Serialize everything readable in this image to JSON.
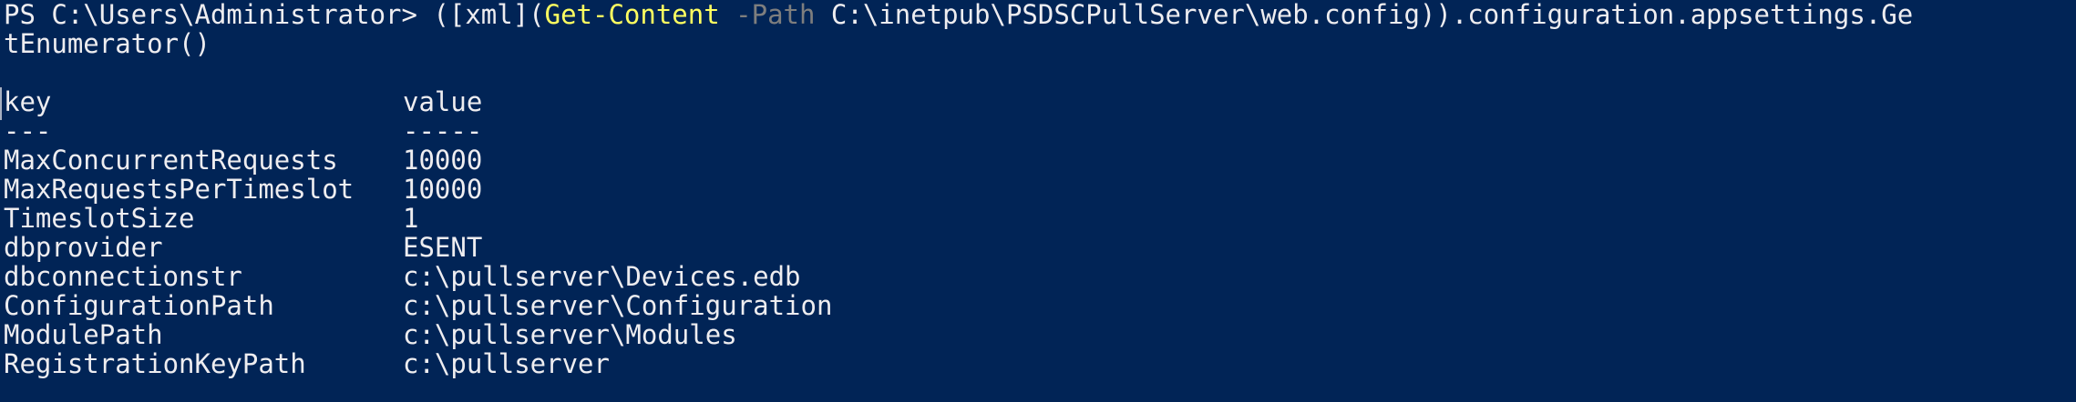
{
  "console": {
    "prompt": "PS C:\\Users\\Administrator> ",
    "command_prefix": "([xml](",
    "cmdlet": "Get-Content",
    "param_name": " -Path",
    "command_rest": " C:\\inetpub\\PSDSCPullServer\\web.config)).configuration.appsettings.Ge",
    "command_wrap": "tEnumerator()",
    "colors": {
      "background": "#012456",
      "text": "#eeedf0",
      "cmdlet": "#ffff60",
      "parameter": "#7e7e7e"
    }
  },
  "table": {
    "headers": {
      "key": "key",
      "value": "value"
    },
    "separators": {
      "key": "---",
      "value": "-----"
    },
    "rows": [
      {
        "key": "MaxConcurrentRequests",
        "value": "10000"
      },
      {
        "key": "MaxRequestsPerTimeslot",
        "value": "10000"
      },
      {
        "key": "TimeslotSize",
        "value": "1"
      },
      {
        "key": "dbprovider",
        "value": "ESENT"
      },
      {
        "key": "dbconnectionstr",
        "value": "c:\\pullserver\\Devices.edb"
      },
      {
        "key": "ConfigurationPath",
        "value": "c:\\pullserver\\Configuration"
      },
      {
        "key": "ModulePath",
        "value": "c:\\pullserver\\Modules"
      },
      {
        "key": "RegistrationKeyPath",
        "value": "c:\\pullserver"
      }
    ]
  }
}
